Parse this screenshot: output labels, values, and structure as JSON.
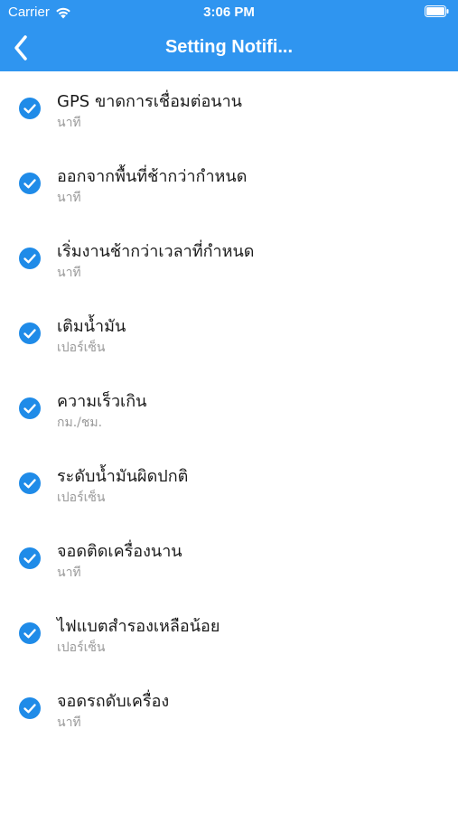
{
  "status_bar": {
    "carrier": "Carrier",
    "time": "3:06 PM"
  },
  "nav": {
    "title": "Setting Notifi..."
  },
  "colors": {
    "header": "#2f95f0",
    "check": "#1f8be8",
    "subtitle": "#9a9a9a"
  },
  "settings": [
    {
      "title": "GPS ขาดการเชื่อมต่อนาน",
      "unit": "นาที",
      "checked": true
    },
    {
      "title": "ออกจากพื้นที่ช้ากว่ากำหนด",
      "unit": "นาที",
      "checked": true
    },
    {
      "title": "เริ่มงานช้ากว่าเวลาที่กำหนด",
      "unit": "นาที",
      "checked": true
    },
    {
      "title": "เติมน้ำมัน",
      "unit": "เปอร์เซ็น",
      "checked": true
    },
    {
      "title": "ความเร็วเกิน",
      "unit": "กม./ชม.",
      "checked": true
    },
    {
      "title": "ระดับน้ำมันผิดปกติ",
      "unit": "เปอร์เซ็น",
      "checked": true
    },
    {
      "title": "จอดติดเครื่องนาน",
      "unit": "นาที",
      "checked": true
    },
    {
      "title": "ไฟแบตสำรองเหลือน้อย",
      "unit": "เปอร์เซ็น",
      "checked": true
    },
    {
      "title": "จอดรถดับเครื่อง",
      "unit": "นาที",
      "checked": true
    }
  ]
}
